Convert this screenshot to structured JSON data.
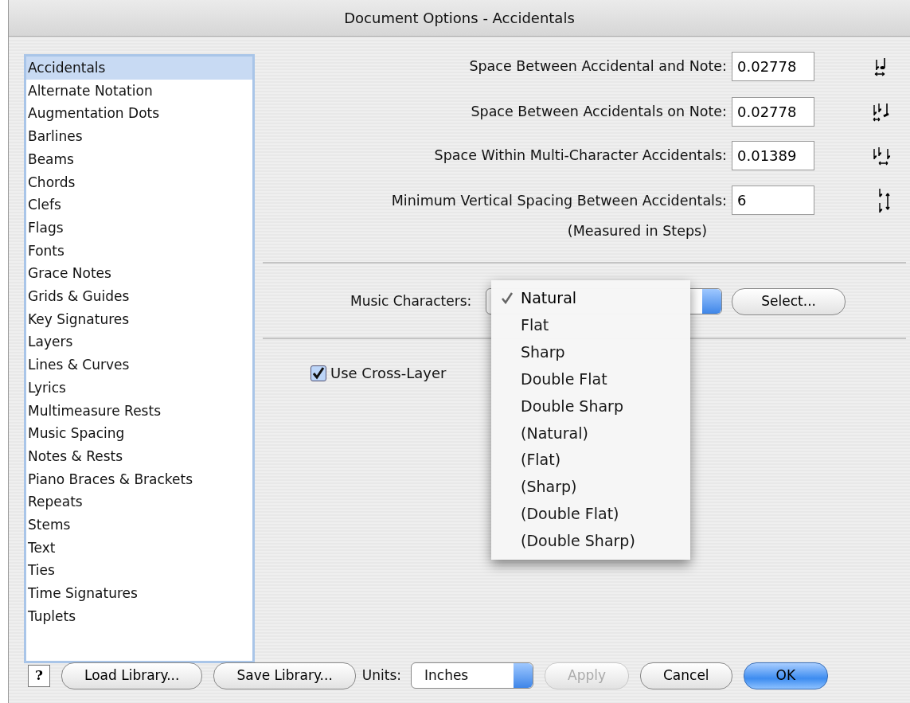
{
  "window": {
    "title": "Document Options - Accidentals"
  },
  "sidebar": {
    "items": [
      {
        "label": "Accidentals",
        "selected": true
      },
      {
        "label": "Alternate Notation",
        "selected": false
      },
      {
        "label": "Augmentation Dots",
        "selected": false
      },
      {
        "label": "Barlines",
        "selected": false
      },
      {
        "label": "Beams",
        "selected": false
      },
      {
        "label": "Chords",
        "selected": false
      },
      {
        "label": "Clefs",
        "selected": false
      },
      {
        "label": "Flags",
        "selected": false
      },
      {
        "label": "Fonts",
        "selected": false
      },
      {
        "label": "Grace Notes",
        "selected": false
      },
      {
        "label": "Grids & Guides",
        "selected": false
      },
      {
        "label": "Key Signatures",
        "selected": false
      },
      {
        "label": "Layers",
        "selected": false
      },
      {
        "label": "Lines & Curves",
        "selected": false
      },
      {
        "label": "Lyrics",
        "selected": false
      },
      {
        "label": "Multimeasure Rests",
        "selected": false
      },
      {
        "label": "Music Spacing",
        "selected": false
      },
      {
        "label": "Notes & Rests",
        "selected": false
      },
      {
        "label": "Piano Braces & Brackets",
        "selected": false
      },
      {
        "label": "Repeats",
        "selected": false
      },
      {
        "label": "Stems",
        "selected": false
      },
      {
        "label": "Text",
        "selected": false
      },
      {
        "label": "Ties",
        "selected": false
      },
      {
        "label": "Time Signatures",
        "selected": false
      },
      {
        "label": "Tuplets",
        "selected": false
      }
    ]
  },
  "fields": [
    {
      "label": "Space Between Accidental and Note:",
      "value": "0.02778"
    },
    {
      "label": "Space Between Accidentals on Note:",
      "value": "0.02778"
    },
    {
      "label": "Space Within Multi-Character Accidentals:",
      "value": "0.01389"
    },
    {
      "label": "Minimum Vertical Spacing Between Accidentals:",
      "value": "6",
      "note": "(Measured in Steps)"
    }
  ],
  "music_characters": {
    "label": "Music Characters:",
    "button": "Select...",
    "menu": [
      {
        "label": "Natural",
        "selected": true
      },
      {
        "label": "Flat",
        "selected": false
      },
      {
        "label": "Sharp",
        "selected": false
      },
      {
        "label": "Double Flat",
        "selected": false
      },
      {
        "label": "Double Sharp",
        "selected": false
      },
      {
        "label": "(Natural)",
        "selected": false
      },
      {
        "label": "(Flat)",
        "selected": false
      },
      {
        "label": "(Sharp)",
        "selected": false
      },
      {
        "label": "(Double Flat)",
        "selected": false
      },
      {
        "label": "(Double Sharp)",
        "selected": false
      }
    ]
  },
  "checkbox": {
    "label": "Use Cross-Layer",
    "checked": true
  },
  "footer": {
    "help": "?",
    "units_label": "Units:",
    "units_value": "Inches",
    "buttons": [
      {
        "label": "Load Library...",
        "disabled": false,
        "default": false
      },
      {
        "label": "Save Library...",
        "disabled": false,
        "default": false
      }
    ],
    "actions": [
      {
        "label": "Apply",
        "disabled": true,
        "default": false
      },
      {
        "label": "Cancel",
        "disabled": false,
        "default": false
      },
      {
        "label": "OK",
        "disabled": false,
        "default": true
      }
    ]
  }
}
